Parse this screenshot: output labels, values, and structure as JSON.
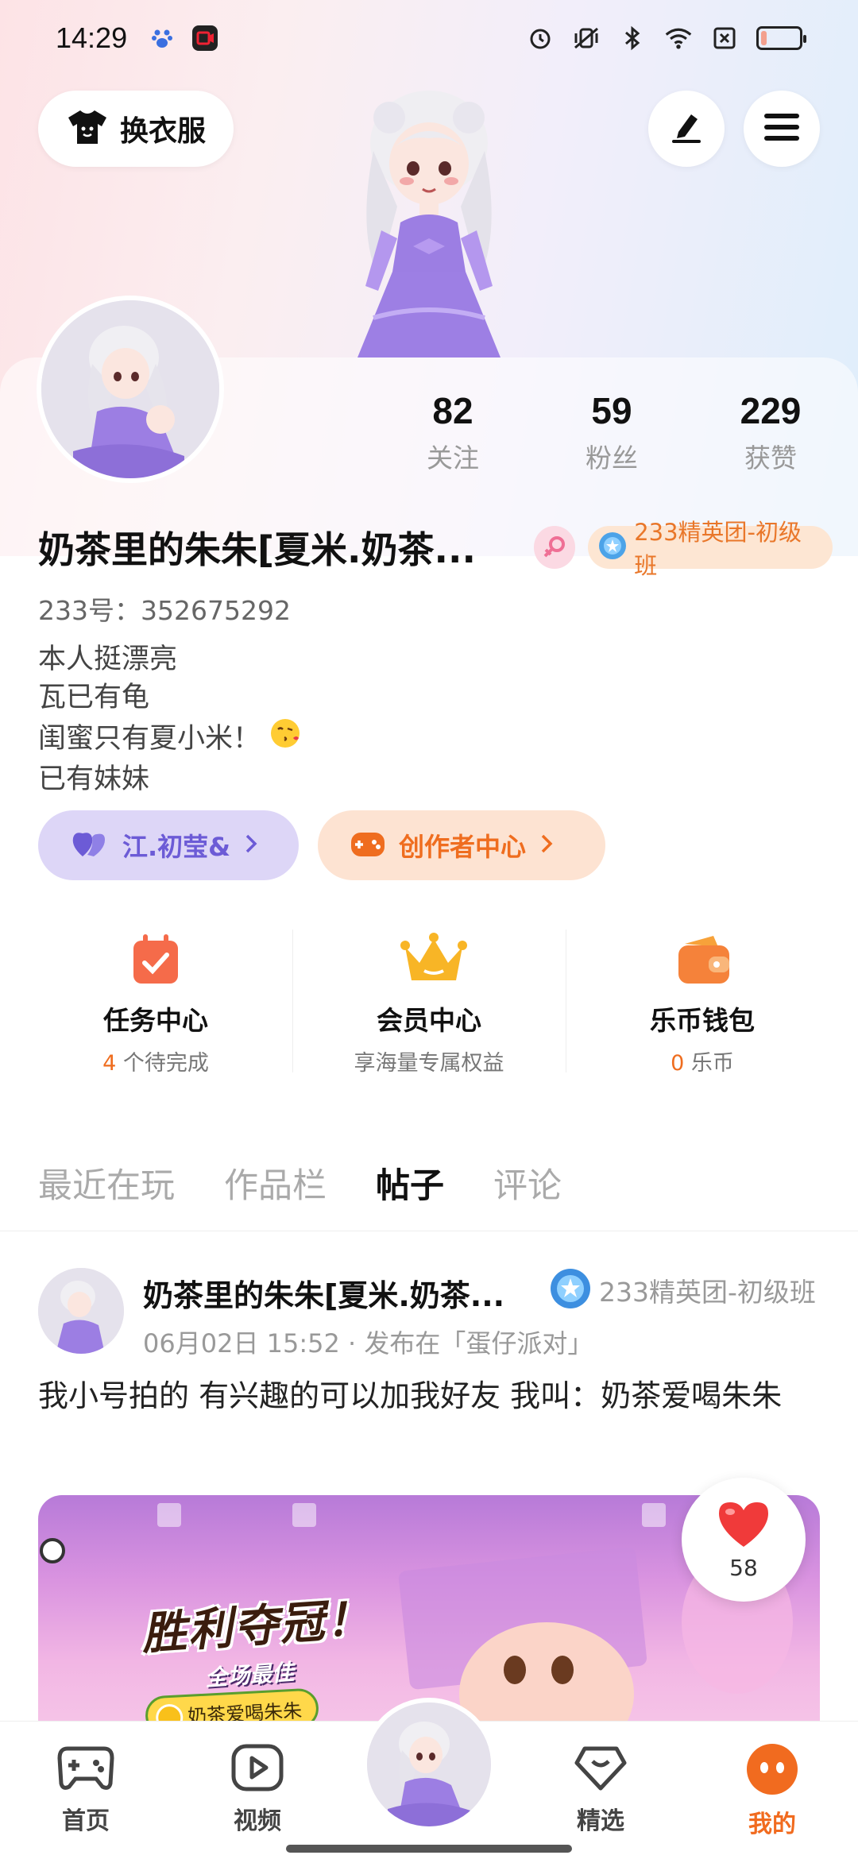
{
  "status_bar": {
    "time": "14:29",
    "left_icons": [
      "baidu-paw-icon",
      "screen-record-icon"
    ],
    "right_icons": [
      "alarm-icon",
      "vibrate-mute-icon",
      "bluetooth-icon",
      "wifi-icon",
      "no-sim-icon",
      "battery-icon"
    ],
    "battery_level": 0.15
  },
  "header": {
    "dress_button_label": "换衣服",
    "edit_icon": "pencil-icon",
    "menu_icon": "hamburger-menu-icon"
  },
  "profile": {
    "stats": [
      {
        "value": "82",
        "label": "关注"
      },
      {
        "value": "59",
        "label": "粉丝"
      },
      {
        "value": "229",
        "label": "获赞"
      }
    ],
    "username": "奶茶里的朱朱[夏米.奶茶...",
    "gender_icon": "female-icon",
    "level_badge": "233精英团-初级班",
    "uid": "233号：352675292",
    "bio": [
      "本人挺漂亮",
      "瓦已有龟",
      "闺蜜只有夏小米！",
      "已有妹妹"
    ],
    "bio_emoji": "😘",
    "friend_pill": "江.初莹&",
    "creator_pill": "创作者中心"
  },
  "services": [
    {
      "title": "任务中心",
      "sub_highlight": "4",
      "sub_text": " 个待完成",
      "icon": "task-calendar-icon"
    },
    {
      "title": "会员中心",
      "sub_highlight": "",
      "sub_text": "享海量专属权益",
      "icon": "crown-icon"
    },
    {
      "title": "乐币钱包",
      "sub_highlight": "0",
      "sub_text": " 乐币",
      "icon": "wallet-icon"
    }
  ],
  "tabs": [
    {
      "label": "最近在玩",
      "active": false
    },
    {
      "label": "作品栏",
      "active": false
    },
    {
      "label": "帖子",
      "active": true
    },
    {
      "label": "评论",
      "active": false
    }
  ],
  "post": {
    "author": "奶茶里的朱朱[夏米.奶茶...",
    "badge": "233精英团-初级班",
    "meta": "06月02日 15:52 · 发布在「蛋仔派对」",
    "text": "我小号拍的 有兴趣的可以加我好友 我叫：奶茶爱喝朱朱",
    "image": {
      "banner": "胜利夺冠！",
      "best_label": "全场最佳",
      "player_tag": "奶茶爱喝朱朱"
    },
    "likes": "58"
  },
  "bottom_nav": [
    {
      "label": "首页",
      "icon": "gamepad-icon",
      "active": false
    },
    {
      "label": "视频",
      "icon": "video-play-icon",
      "active": false
    },
    {
      "label": "精选",
      "icon": "heart-gem-icon",
      "active": false
    },
    {
      "label": "我的",
      "icon": "profile-face-icon",
      "active": true
    }
  ],
  "colors": {
    "accent_orange": "#f16b1f",
    "purple": "#6c5bd6"
  }
}
